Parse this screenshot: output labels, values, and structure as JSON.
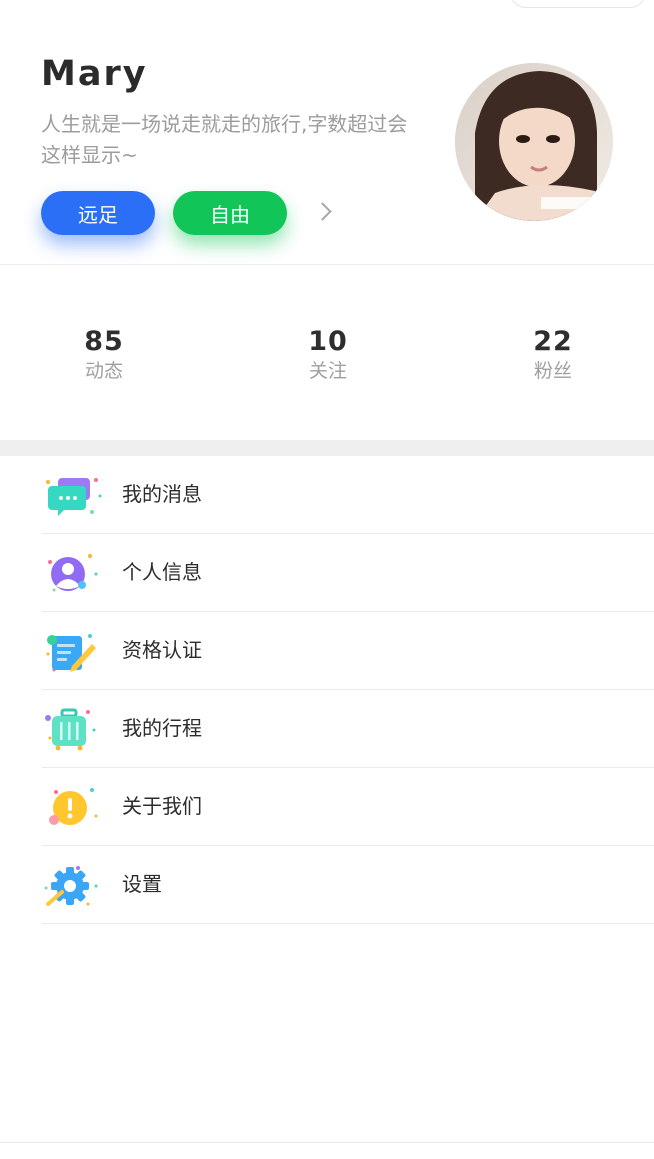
{
  "profile": {
    "name": "Mary",
    "bio": "人生就是一场说走就走的旅行,字数超过会这样显示~",
    "tags": [
      "远足",
      "自由"
    ],
    "avatar_icon": "user-avatar-photo"
  },
  "stats": [
    {
      "value": "85",
      "label": "动态"
    },
    {
      "value": "10",
      "label": "关注"
    },
    {
      "value": "22",
      "label": "粉丝"
    }
  ],
  "menu": [
    {
      "label": "我的消息",
      "icon": "message-icon"
    },
    {
      "label": "个人信息",
      "icon": "person-icon"
    },
    {
      "label": "资格认证",
      "icon": "certificate-icon"
    },
    {
      "label": "我的行程",
      "icon": "luggage-icon"
    },
    {
      "label": "关于我们",
      "icon": "info-icon"
    },
    {
      "label": "设置",
      "icon": "gear-icon"
    }
  ],
  "colors": {
    "tag_blue": "#2a6ff5",
    "tag_green": "#12c558"
  }
}
